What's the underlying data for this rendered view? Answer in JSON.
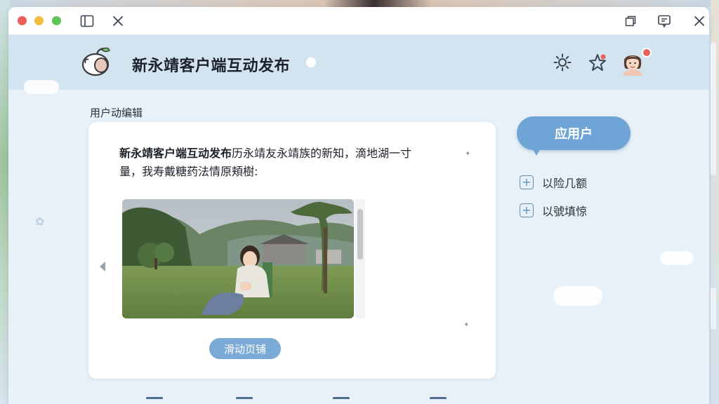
{
  "window": {
    "title_icons": [
      "sidebar-toggle-icon",
      "close-tab-icon",
      "window-restore-icon",
      "message-icon",
      "window-close-icon"
    ]
  },
  "header": {
    "app_title": "新永靖客户端互动发布",
    "icons": [
      "settings-icon",
      "favorite-icon",
      "user-avatar"
    ]
  },
  "main": {
    "section_label": "用户动编辑",
    "post": {
      "lead": "新永靖客户端互动发布",
      "line1_rest": "历永靖友永靖族的新知，滴地湖一寸",
      "line2": "量，我寿戴糖药法情原頬樹:"
    },
    "primary_action": "滑动页铺"
  },
  "sidebar": {
    "primary_button": "应用户",
    "links": [
      {
        "label": "以险几额"
      },
      {
        "label": "以號填惊"
      }
    ]
  },
  "colors": {
    "accent": "#6fa4d6",
    "header_bg": "#d3e4f1",
    "window_bg": "#e8f1f8"
  }
}
